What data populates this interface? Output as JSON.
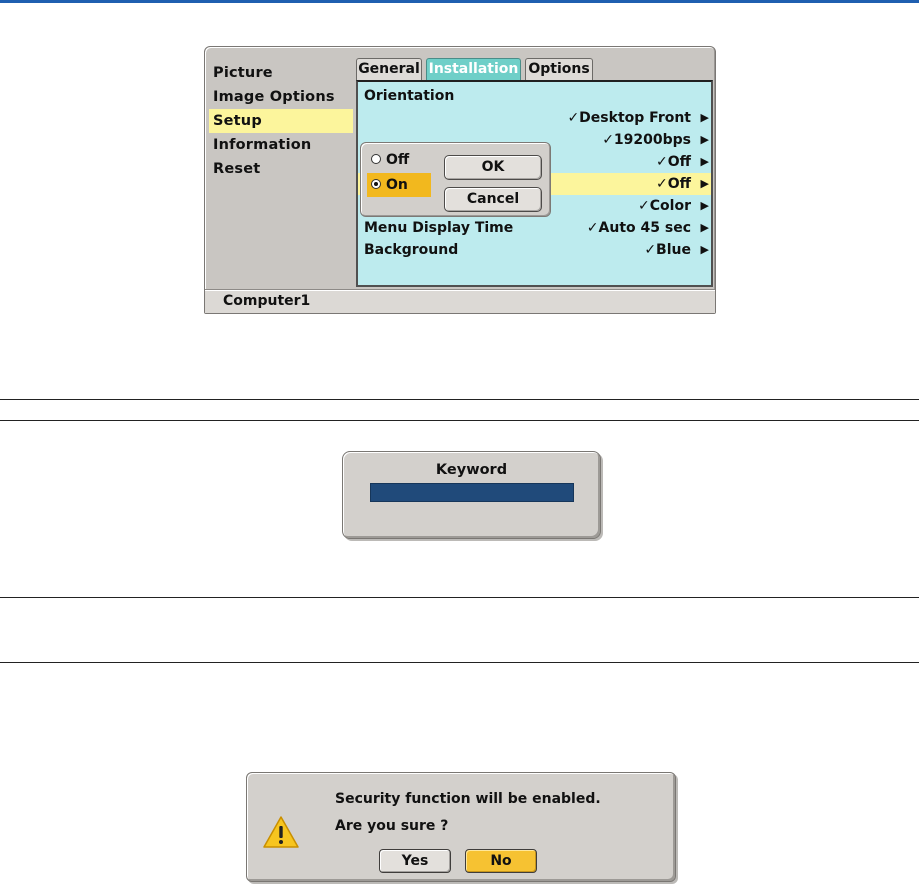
{
  "colors": {
    "panel_bg": "#bdebee",
    "highlight": "#fcf59c",
    "active_tab": "#6fcfc8",
    "selected_radio": "#f2b81e",
    "keyword_field": "#204a7a",
    "no_button": "#f6c232"
  },
  "menu": {
    "sidebar": [
      {
        "label": "Picture"
      },
      {
        "label": "Image Options"
      },
      {
        "label": "Setup",
        "selected": true
      },
      {
        "label": "Information"
      },
      {
        "label": "Reset"
      }
    ],
    "tabs": [
      {
        "label": "General"
      },
      {
        "label": "Installation",
        "active": true
      },
      {
        "label": "Options"
      }
    ],
    "rows": [
      {
        "label": "Orientation",
        "value": ""
      },
      {
        "label": "",
        "value": "✓Desktop Front"
      },
      {
        "label": "",
        "value": "✓19200bps"
      },
      {
        "label": "",
        "value": "✓Off"
      },
      {
        "label": "",
        "value": "✓Off"
      },
      {
        "label": "",
        "value": "✓Color"
      },
      {
        "label": "Menu Display Time",
        "value": "✓Auto 45 sec"
      },
      {
        "label": "Background",
        "value": "✓Blue"
      }
    ],
    "arrow_glyph": "▶",
    "popup": {
      "options": [
        {
          "label": "Off",
          "checked": false
        },
        {
          "label": "On",
          "checked": true
        }
      ],
      "ok_label": "OK",
      "cancel_label": "Cancel"
    },
    "status_text": "Computer1"
  },
  "keyword_dialog": {
    "title": "Keyword",
    "value": ""
  },
  "confirm_dialog": {
    "icon": "warning-icon",
    "line1": "Security function will be enabled.",
    "line2": "Are you sure ?",
    "yes_label": "Yes",
    "no_label": "No"
  }
}
